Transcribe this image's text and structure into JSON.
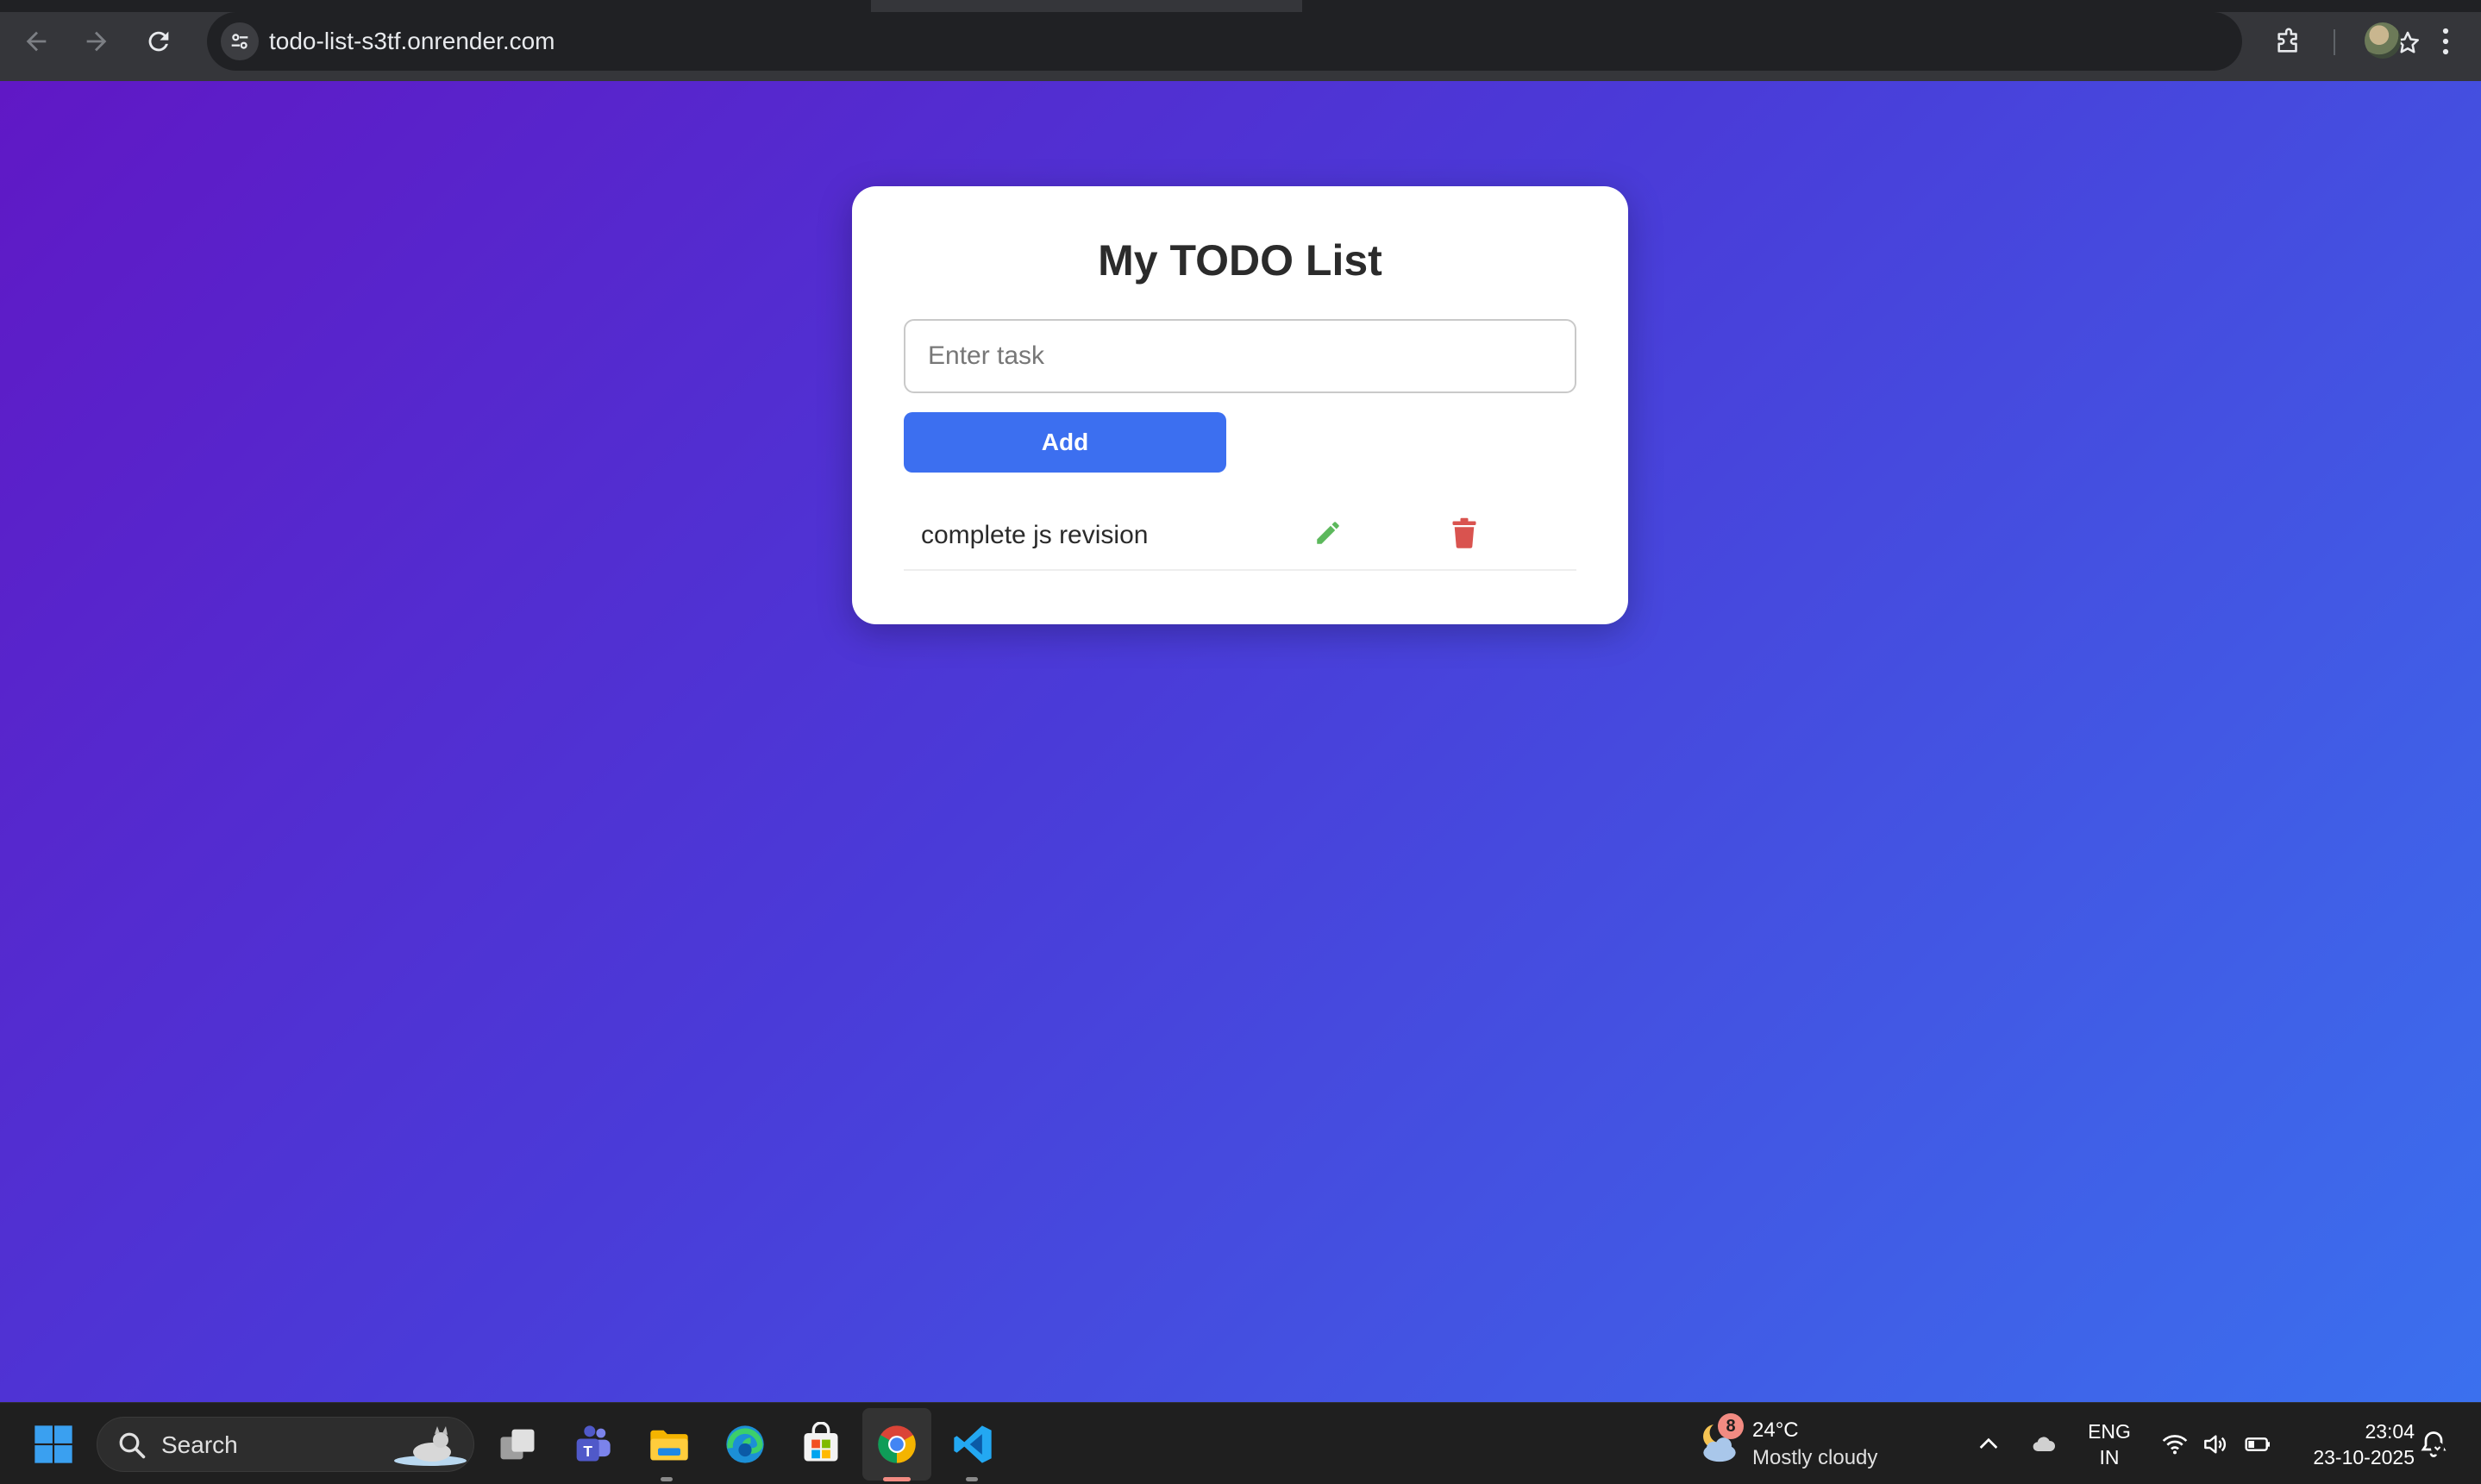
{
  "browser": {
    "url": "todo-list-s3tf.onrender.com",
    "icons": {
      "back": "arrow-left-icon",
      "forward": "arrow-right-icon",
      "reload": "reload-icon",
      "site_info": "tune-icon",
      "bookmark": "star-icon",
      "extensions": "puzzle-icon",
      "profile": "avatar",
      "menu": "kebab-menu-icon"
    }
  },
  "app": {
    "title": "My TODO List",
    "input": {
      "placeholder": "Enter task",
      "value": ""
    },
    "add_label": "Add",
    "tasks": [
      {
        "text": "complete js revision",
        "edit_icon": "pencil-icon",
        "delete_icon": "trash-icon"
      }
    ],
    "colors": {
      "accent": "#3c6ff0",
      "edit": "#5cb85c",
      "delete": "#d9534f",
      "background_start": "#6018c5",
      "background_end": "#3b70ee"
    }
  },
  "taskbar": {
    "search_label": "Search",
    "weather": {
      "badge": "8",
      "temp": "24°C",
      "desc": "Mostly cloudy"
    },
    "language": {
      "line1": "ENG",
      "line2": "IN"
    },
    "clock": {
      "time": "23:04",
      "date": "23-10-2025"
    },
    "apps": [
      "windows-start-icon",
      "task-view-icon",
      "teams-icon",
      "file-explorer-icon",
      "edge-icon",
      "store-icon",
      "chrome-icon",
      "vscode-icon"
    ]
  }
}
